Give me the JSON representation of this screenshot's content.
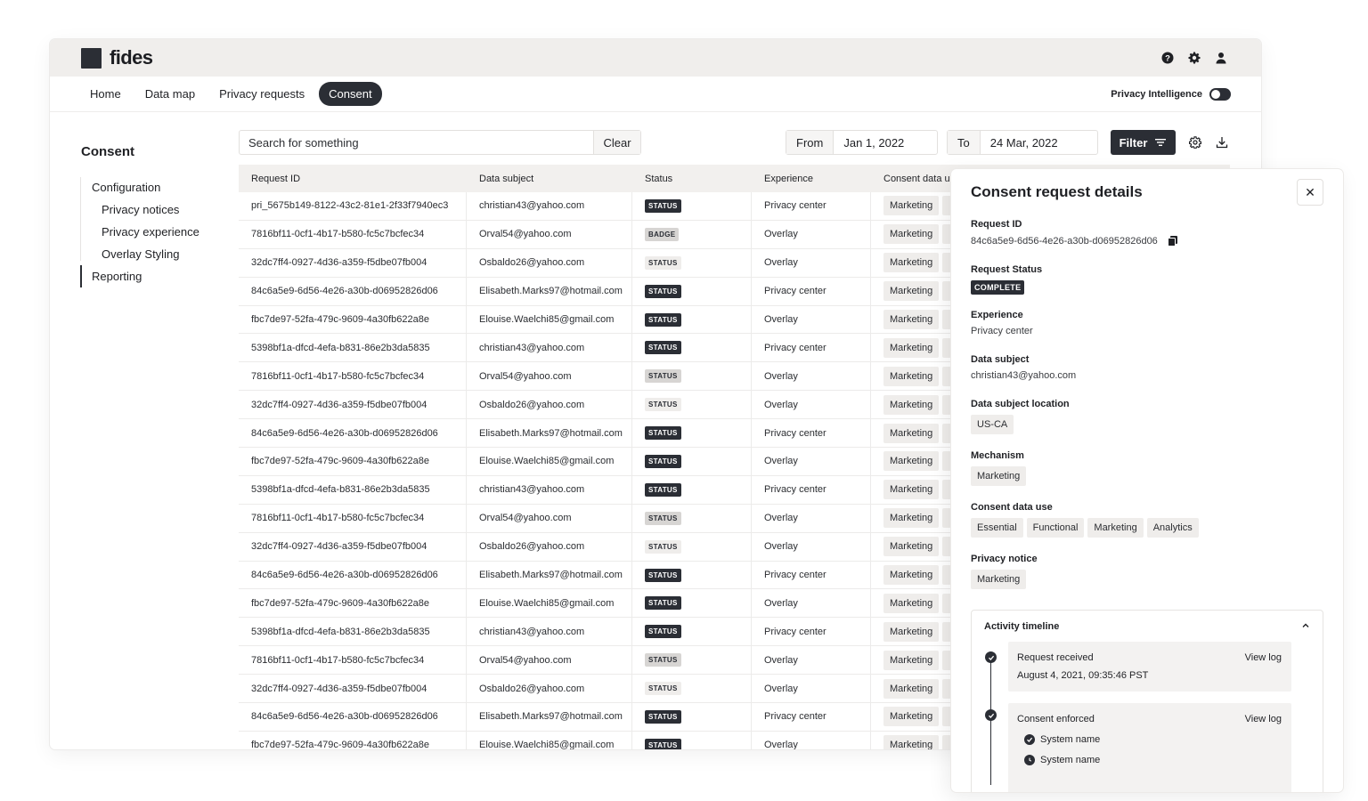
{
  "app": {
    "name": "fides"
  },
  "nav": {
    "items": [
      "Home",
      "Data map",
      "Privacy requests",
      "Consent"
    ],
    "active": "Consent",
    "privacy_intelligence_label": "Privacy Intelligence"
  },
  "sidebar": {
    "title": "Consent",
    "items": [
      {
        "label": "Configuration"
      },
      {
        "label": "Privacy notices"
      },
      {
        "label": "Privacy experience"
      },
      {
        "label": "Overlay Styling"
      },
      {
        "label": "Reporting"
      }
    ]
  },
  "toolbar": {
    "search_placeholder": "Search for something",
    "clear_label": "Clear",
    "from_label": "From",
    "from_value": "Jan 1, 2022",
    "to_label": "To",
    "to_value": "24 Mar, 2022",
    "filter_label": "Filter"
  },
  "table": {
    "headers": [
      "Request ID",
      "Data subject",
      "Status",
      "Experience",
      "Consent data u"
    ],
    "rows": [
      {
        "id": "pri_5675b149-8122-43c2-81e1-2f33f7940ec3",
        "subject": "christian43@yahoo.com",
        "status": "STATUS",
        "status_style": "dark",
        "experience": "Privacy center",
        "consent": "Marketing"
      },
      {
        "id": "7816bf11-0cf1-4b17-b580-fc5c7bcfec34",
        "subject": "Orval54@yahoo.com",
        "status": "BADGE",
        "status_style": "light",
        "experience": "Overlay",
        "consent": "Marketing"
      },
      {
        "id": "32dc7ff4-0927-4d36-a359-f5dbe07fb004",
        "subject": "Osbaldo26@yahoo.com",
        "status": "STATUS",
        "status_style": "outline",
        "experience": "Overlay",
        "consent": "Marketing"
      },
      {
        "id": "84c6a5e9-6d56-4e26-a30b-d06952826d06",
        "subject": "Elisabeth.Marks97@hotmail.com",
        "status": "STATUS",
        "status_style": "dark",
        "experience": "Privacy center",
        "consent": "Marketing"
      },
      {
        "id": "fbc7de97-52fa-479c-9609-4a30fb622a8e",
        "subject": "Elouise.Waelchi85@gmail.com",
        "status": "STATUS",
        "status_style": "dark",
        "experience": "Overlay",
        "consent": "Marketing"
      },
      {
        "id": "5398bf1a-dfcd-4efa-b831-86e2b3da5835",
        "subject": "christian43@yahoo.com",
        "status": "STATUS",
        "status_style": "dark",
        "experience": "Privacy center",
        "consent": "Marketing"
      },
      {
        "id": "7816bf11-0cf1-4b17-b580-fc5c7bcfec34",
        "subject": "Orval54@yahoo.com",
        "status": "STATUS",
        "status_style": "light",
        "experience": "Overlay",
        "consent": "Marketing"
      },
      {
        "id": "32dc7ff4-0927-4d36-a359-f5dbe07fb004",
        "subject": "Osbaldo26@yahoo.com",
        "status": "STATUS",
        "status_style": "outline",
        "experience": "Overlay",
        "consent": "Marketing"
      },
      {
        "id": "84c6a5e9-6d56-4e26-a30b-d06952826d06",
        "subject": "Elisabeth.Marks97@hotmail.com",
        "status": "STATUS",
        "status_style": "dark",
        "experience": "Privacy center",
        "consent": "Marketing"
      },
      {
        "id": "fbc7de97-52fa-479c-9609-4a30fb622a8e",
        "subject": "Elouise.Waelchi85@gmail.com",
        "status": "STATUS",
        "status_style": "dark",
        "experience": "Overlay",
        "consent": "Marketing"
      },
      {
        "id": "5398bf1a-dfcd-4efa-b831-86e2b3da5835",
        "subject": "christian43@yahoo.com",
        "status": "STATUS",
        "status_style": "dark",
        "experience": "Privacy center",
        "consent": "Marketing"
      },
      {
        "id": "7816bf11-0cf1-4b17-b580-fc5c7bcfec34",
        "subject": "Orval54@yahoo.com",
        "status": "STATUS",
        "status_style": "light",
        "experience": "Overlay",
        "consent": "Marketing"
      },
      {
        "id": "32dc7ff4-0927-4d36-a359-f5dbe07fb004",
        "subject": "Osbaldo26@yahoo.com",
        "status": "STATUS",
        "status_style": "outline",
        "experience": "Overlay",
        "consent": "Marketing"
      },
      {
        "id": "84c6a5e9-6d56-4e26-a30b-d06952826d06",
        "subject": "Elisabeth.Marks97@hotmail.com",
        "status": "STATUS",
        "status_style": "dark",
        "experience": "Privacy center",
        "consent": "Marketing"
      },
      {
        "id": "fbc7de97-52fa-479c-9609-4a30fb622a8e",
        "subject": "Elouise.Waelchi85@gmail.com",
        "status": "STATUS",
        "status_style": "dark",
        "experience": "Overlay",
        "consent": "Marketing"
      },
      {
        "id": "5398bf1a-dfcd-4efa-b831-86e2b3da5835",
        "subject": "christian43@yahoo.com",
        "status": "STATUS",
        "status_style": "dark",
        "experience": "Privacy center",
        "consent": "Marketing"
      },
      {
        "id": "7816bf11-0cf1-4b17-b580-fc5c7bcfec34",
        "subject": "Orval54@yahoo.com",
        "status": "STATUS",
        "status_style": "light",
        "experience": "Overlay",
        "consent": "Marketing"
      },
      {
        "id": "32dc7ff4-0927-4d36-a359-f5dbe07fb004",
        "subject": "Osbaldo26@yahoo.com",
        "status": "STATUS",
        "status_style": "outline",
        "experience": "Overlay",
        "consent": "Marketing"
      },
      {
        "id": "84c6a5e9-6d56-4e26-a30b-d06952826d06",
        "subject": "Elisabeth.Marks97@hotmail.com",
        "status": "STATUS",
        "status_style": "dark",
        "experience": "Privacy center",
        "consent": "Marketing"
      },
      {
        "id": "fbc7de97-52fa-479c-9609-4a30fb622a8e",
        "subject": "Elouise.Waelchi85@gmail.com",
        "status": "STATUS",
        "status_style": "dark",
        "experience": "Overlay",
        "consent": "Marketing"
      }
    ]
  },
  "detail": {
    "title": "Consent request details",
    "request_id_label": "Request ID",
    "request_id": "84c6a5e9-6d56-4e26-a30b-d06952826d06",
    "status_label": "Request Status",
    "status": "COMPLETE",
    "experience_label": "Experience",
    "experience": "Privacy center",
    "subject_label": "Data subject",
    "subject": "christian43@yahoo.com",
    "location_label": "Data subject location",
    "location": "US-CA",
    "mechanism_label": "Mechanism",
    "mechanism": "Marketing",
    "consent_use_label": "Consent data use",
    "consent_uses": [
      "Essential",
      "Functional",
      "Marketing",
      "Analytics"
    ],
    "notice_label": "Privacy notice",
    "notice": "Marketing",
    "timeline": {
      "title": "Activity timeline",
      "events": [
        {
          "title": "Request received",
          "time": "August 4, 2021, 09:35:46 PST",
          "action": "View log"
        },
        {
          "title": "Consent enforced",
          "action": "View log",
          "systems": [
            "System name",
            "System name"
          ]
        }
      ]
    }
  },
  "colors": {
    "primary": "#2b2e35",
    "topbar": "#f0eeec",
    "tag_bg": "#efedeb"
  }
}
